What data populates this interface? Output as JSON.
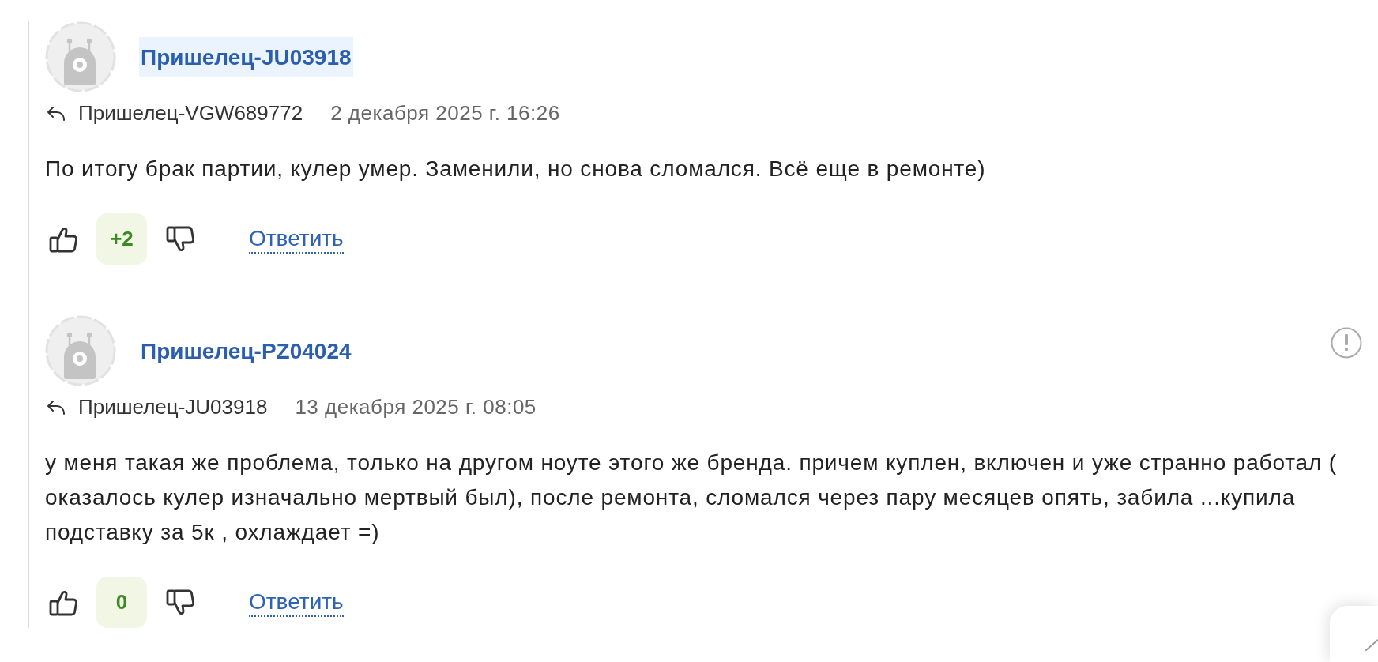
{
  "comments": [
    {
      "author": "Пришелец-JU03918",
      "highlighted": true,
      "report": false,
      "reply_to": "Пришелец-VGW689772",
      "date": "2 декабря 2025 г. 16:26",
      "text": "По итогу брак партии, кулер умер. Заменили, но снова сломался. Всё еще в ремонте)",
      "score": "+2",
      "reply_label": "Ответить"
    },
    {
      "author": "Пришелец-PZ04024",
      "highlighted": false,
      "report": true,
      "reply_to": "Пришелец-JU03918",
      "date": "13 декабря 2025 г. 08:05",
      "text": "у меня такая же проблема, только на другом ноуте этого же бренда. причем куплен, включен и уже странно работал ( оказалось кулер изначально мертвый был), после ремонта, сломался через пару месяцев опять, забила ...купила подставку за 5к , охлаждает =)",
      "score": "0",
      "reply_label": "Ответить"
    }
  ]
}
